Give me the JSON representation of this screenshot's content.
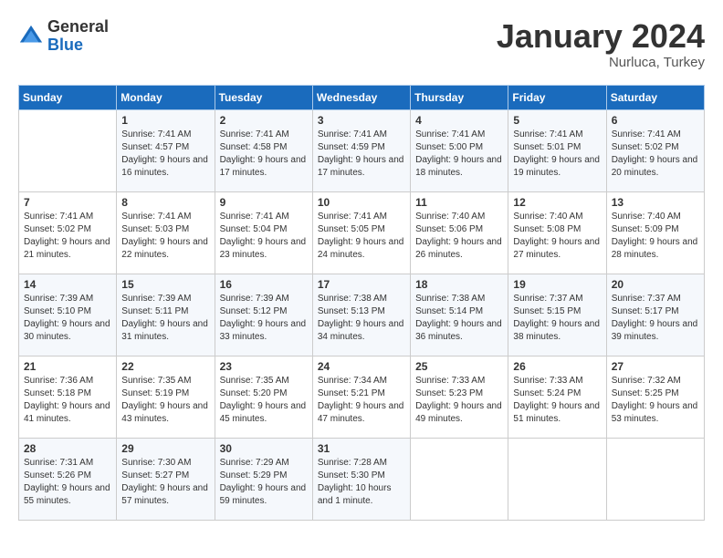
{
  "header": {
    "logo_general": "General",
    "logo_blue": "Blue",
    "month_title": "January 2024",
    "location": "Nurluca, Turkey"
  },
  "columns": [
    "Sunday",
    "Monday",
    "Tuesday",
    "Wednesday",
    "Thursday",
    "Friday",
    "Saturday"
  ],
  "weeks": [
    [
      {
        "day": "",
        "sunrise": "",
        "sunset": "",
        "daylight": ""
      },
      {
        "day": "1",
        "sunrise": "Sunrise: 7:41 AM",
        "sunset": "Sunset: 4:57 PM",
        "daylight": "Daylight: 9 hours and 16 minutes."
      },
      {
        "day": "2",
        "sunrise": "Sunrise: 7:41 AM",
        "sunset": "Sunset: 4:58 PM",
        "daylight": "Daylight: 9 hours and 17 minutes."
      },
      {
        "day": "3",
        "sunrise": "Sunrise: 7:41 AM",
        "sunset": "Sunset: 4:59 PM",
        "daylight": "Daylight: 9 hours and 17 minutes."
      },
      {
        "day": "4",
        "sunrise": "Sunrise: 7:41 AM",
        "sunset": "Sunset: 5:00 PM",
        "daylight": "Daylight: 9 hours and 18 minutes."
      },
      {
        "day": "5",
        "sunrise": "Sunrise: 7:41 AM",
        "sunset": "Sunset: 5:01 PM",
        "daylight": "Daylight: 9 hours and 19 minutes."
      },
      {
        "day": "6",
        "sunrise": "Sunrise: 7:41 AM",
        "sunset": "Sunset: 5:02 PM",
        "daylight": "Daylight: 9 hours and 20 minutes."
      }
    ],
    [
      {
        "day": "7",
        "sunrise": "Sunrise: 7:41 AM",
        "sunset": "Sunset: 5:02 PM",
        "daylight": "Daylight: 9 hours and 21 minutes."
      },
      {
        "day": "8",
        "sunrise": "Sunrise: 7:41 AM",
        "sunset": "Sunset: 5:03 PM",
        "daylight": "Daylight: 9 hours and 22 minutes."
      },
      {
        "day": "9",
        "sunrise": "Sunrise: 7:41 AM",
        "sunset": "Sunset: 5:04 PM",
        "daylight": "Daylight: 9 hours and 23 minutes."
      },
      {
        "day": "10",
        "sunrise": "Sunrise: 7:41 AM",
        "sunset": "Sunset: 5:05 PM",
        "daylight": "Daylight: 9 hours and 24 minutes."
      },
      {
        "day": "11",
        "sunrise": "Sunrise: 7:40 AM",
        "sunset": "Sunset: 5:06 PM",
        "daylight": "Daylight: 9 hours and 26 minutes."
      },
      {
        "day": "12",
        "sunrise": "Sunrise: 7:40 AM",
        "sunset": "Sunset: 5:08 PM",
        "daylight": "Daylight: 9 hours and 27 minutes."
      },
      {
        "day": "13",
        "sunrise": "Sunrise: 7:40 AM",
        "sunset": "Sunset: 5:09 PM",
        "daylight": "Daylight: 9 hours and 28 minutes."
      }
    ],
    [
      {
        "day": "14",
        "sunrise": "Sunrise: 7:39 AM",
        "sunset": "Sunset: 5:10 PM",
        "daylight": "Daylight: 9 hours and 30 minutes."
      },
      {
        "day": "15",
        "sunrise": "Sunrise: 7:39 AM",
        "sunset": "Sunset: 5:11 PM",
        "daylight": "Daylight: 9 hours and 31 minutes."
      },
      {
        "day": "16",
        "sunrise": "Sunrise: 7:39 AM",
        "sunset": "Sunset: 5:12 PM",
        "daylight": "Daylight: 9 hours and 33 minutes."
      },
      {
        "day": "17",
        "sunrise": "Sunrise: 7:38 AM",
        "sunset": "Sunset: 5:13 PM",
        "daylight": "Daylight: 9 hours and 34 minutes."
      },
      {
        "day": "18",
        "sunrise": "Sunrise: 7:38 AM",
        "sunset": "Sunset: 5:14 PM",
        "daylight": "Daylight: 9 hours and 36 minutes."
      },
      {
        "day": "19",
        "sunrise": "Sunrise: 7:37 AM",
        "sunset": "Sunset: 5:15 PM",
        "daylight": "Daylight: 9 hours and 38 minutes."
      },
      {
        "day": "20",
        "sunrise": "Sunrise: 7:37 AM",
        "sunset": "Sunset: 5:17 PM",
        "daylight": "Daylight: 9 hours and 39 minutes."
      }
    ],
    [
      {
        "day": "21",
        "sunrise": "Sunrise: 7:36 AM",
        "sunset": "Sunset: 5:18 PM",
        "daylight": "Daylight: 9 hours and 41 minutes."
      },
      {
        "day": "22",
        "sunrise": "Sunrise: 7:35 AM",
        "sunset": "Sunset: 5:19 PM",
        "daylight": "Daylight: 9 hours and 43 minutes."
      },
      {
        "day": "23",
        "sunrise": "Sunrise: 7:35 AM",
        "sunset": "Sunset: 5:20 PM",
        "daylight": "Daylight: 9 hours and 45 minutes."
      },
      {
        "day": "24",
        "sunrise": "Sunrise: 7:34 AM",
        "sunset": "Sunset: 5:21 PM",
        "daylight": "Daylight: 9 hours and 47 minutes."
      },
      {
        "day": "25",
        "sunrise": "Sunrise: 7:33 AM",
        "sunset": "Sunset: 5:23 PM",
        "daylight": "Daylight: 9 hours and 49 minutes."
      },
      {
        "day": "26",
        "sunrise": "Sunrise: 7:33 AM",
        "sunset": "Sunset: 5:24 PM",
        "daylight": "Daylight: 9 hours and 51 minutes."
      },
      {
        "day": "27",
        "sunrise": "Sunrise: 7:32 AM",
        "sunset": "Sunset: 5:25 PM",
        "daylight": "Daylight: 9 hours and 53 minutes."
      }
    ],
    [
      {
        "day": "28",
        "sunrise": "Sunrise: 7:31 AM",
        "sunset": "Sunset: 5:26 PM",
        "daylight": "Daylight: 9 hours and 55 minutes."
      },
      {
        "day": "29",
        "sunrise": "Sunrise: 7:30 AM",
        "sunset": "Sunset: 5:27 PM",
        "daylight": "Daylight: 9 hours and 57 minutes."
      },
      {
        "day": "30",
        "sunrise": "Sunrise: 7:29 AM",
        "sunset": "Sunset: 5:29 PM",
        "daylight": "Daylight: 9 hours and 59 minutes."
      },
      {
        "day": "31",
        "sunrise": "Sunrise: 7:28 AM",
        "sunset": "Sunset: 5:30 PM",
        "daylight": "Daylight: 10 hours and 1 minute."
      },
      {
        "day": "",
        "sunrise": "",
        "sunset": "",
        "daylight": ""
      },
      {
        "day": "",
        "sunrise": "",
        "sunset": "",
        "daylight": ""
      },
      {
        "day": "",
        "sunrise": "",
        "sunset": "",
        "daylight": ""
      }
    ]
  ]
}
